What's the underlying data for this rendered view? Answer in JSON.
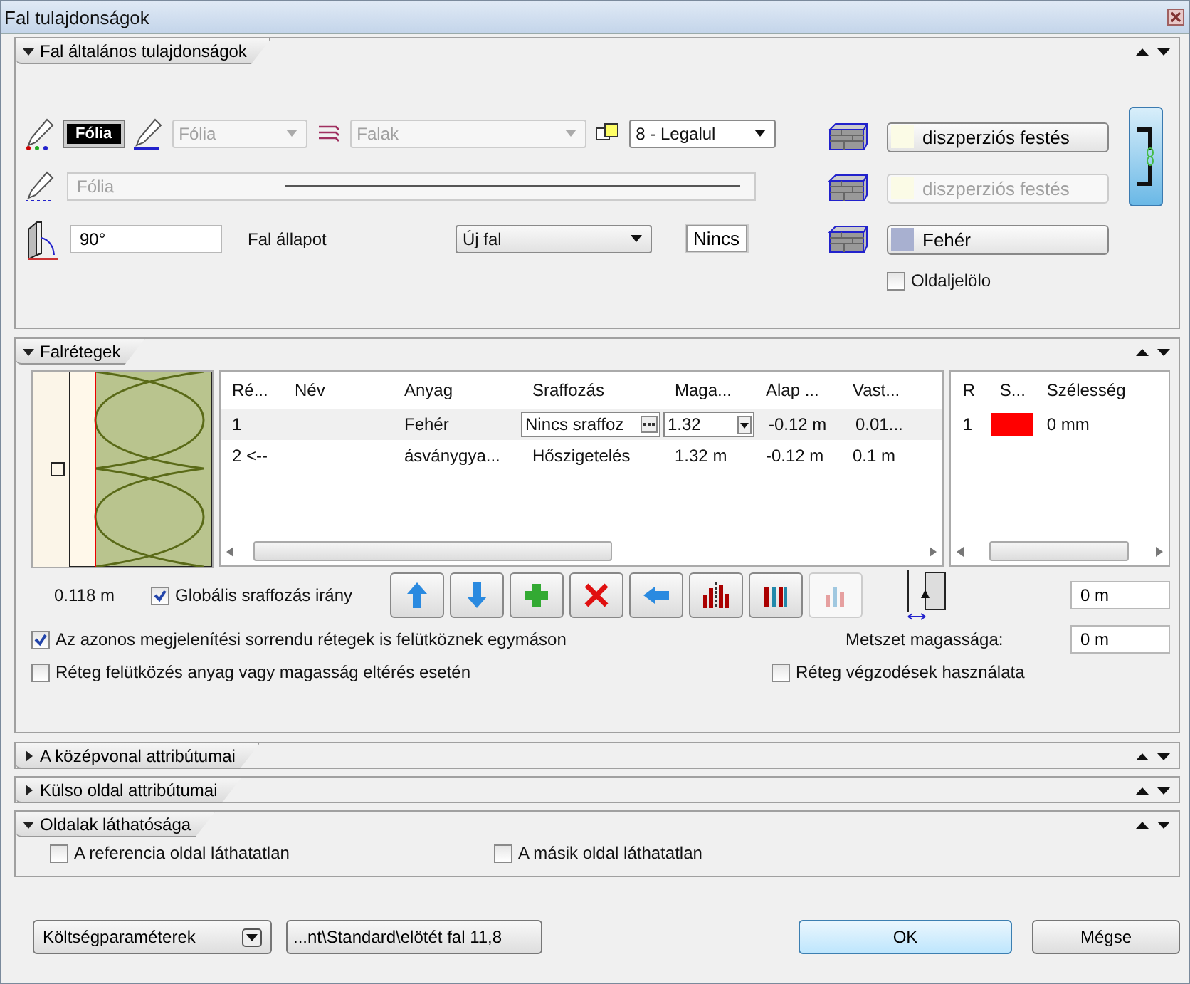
{
  "window": {
    "title": "Fal tulajdonságok"
  },
  "sections": [
    {
      "kind": "general",
      "title": "Fal általános tulajdonságok",
      "expanded": true
    },
    {
      "kind": "layers",
      "title": "Falrétegek",
      "expanded": true
    },
    {
      "kind": "centerline",
      "title": "A középvonal attribútumai",
      "expanded": false
    },
    {
      "kind": "outer",
      "title": "Külso oldal attribútumai",
      "expanded": false
    },
    {
      "kind": "visibility",
      "title": "Oldalak láthatósága",
      "expanded": true
    }
  ],
  "general": {
    "pen_label": "Fólia",
    "line_dropdown": {
      "value": "Fólia",
      "disabled": true
    },
    "layer_dropdown": {
      "value": "Falak",
      "disabled": true
    },
    "order_dropdown": {
      "value": "8 - Legalul",
      "disabled": false
    },
    "fill_field": {
      "value": "Fólia",
      "disabled": true
    },
    "angle": "90°",
    "state_label": "Fal állapot",
    "state_dropdown": "Új fal",
    "none_button": "Nincs",
    "surfaces": [
      {
        "label": "diszperziós festés",
        "disabled": false,
        "color": "#fbfbe6"
      },
      {
        "label": "diszperziós festés",
        "disabled": true,
        "color": "#fbfbe6"
      },
      {
        "label": "Fehér",
        "disabled": false,
        "color": "#a8b0d0"
      }
    ],
    "side_marker": {
      "label": "Oldaljelölo",
      "checked": false
    }
  },
  "layers": {
    "columns": [
      "Ré...",
      "Név",
      "Anyag",
      "Sraffozás",
      "Maga...",
      "Alap ...",
      "Vast..."
    ],
    "rows": [
      {
        "selected": true,
        "cells": [
          "1",
          "",
          "Fehér",
          "Nincs sraffoz",
          "1.32",
          "-0.12 m",
          "0.01..."
        ]
      },
      {
        "selected": false,
        "cells": [
          "2 <--",
          "",
          "ásványgya...",
          "Hőszigetelés",
          "1.32 m",
          "-0.12 m",
          "0.1 m"
        ]
      }
    ],
    "side_columns": [
      "R",
      "S...",
      "Szélesség"
    ],
    "side_rows": [
      {
        "r": "1",
        "color": "#ff0000",
        "width": "0 mm"
      }
    ],
    "thickness": "0.118 m",
    "global_hatch": {
      "label": "Globális sraffozás irány",
      "checked": true
    },
    "toolbar": [
      {
        "kind": "up",
        "disabled": false
      },
      {
        "kind": "down",
        "disabled": false
      },
      {
        "kind": "add",
        "disabled": false
      },
      {
        "kind": "delete",
        "disabled": false
      },
      {
        "kind": "left",
        "disabled": false
      },
      {
        "kind": "split",
        "disabled": false
      },
      {
        "kind": "bars",
        "disabled": false
      },
      {
        "kind": "small",
        "disabled": true
      }
    ],
    "offset": "0 m",
    "collide_same": {
      "label": "Az azonos megjelenítési sorrendu rétegek is felütköznek egymáson",
      "checked": true
    },
    "section_height_label": "Metszet magassága:",
    "section_height": "0 m",
    "collide_material": {
      "label": "Réteg felütközés anyag vagy magasság eltérés esetén",
      "checked": false
    },
    "layer_ends": {
      "label": "Réteg végzodések használata",
      "checked": false
    }
  },
  "visibility": [
    {
      "label": "A referencia oldal láthatatlan",
      "checked": false
    },
    {
      "label": "A másik oldal láthatatlan",
      "checked": false
    }
  ],
  "footer": {
    "cost_button": "Költségparaméterek",
    "path_button": "...nt\\Standard\\elötét fal 11,8",
    "ok": "OK",
    "cancel": "Mégse"
  }
}
